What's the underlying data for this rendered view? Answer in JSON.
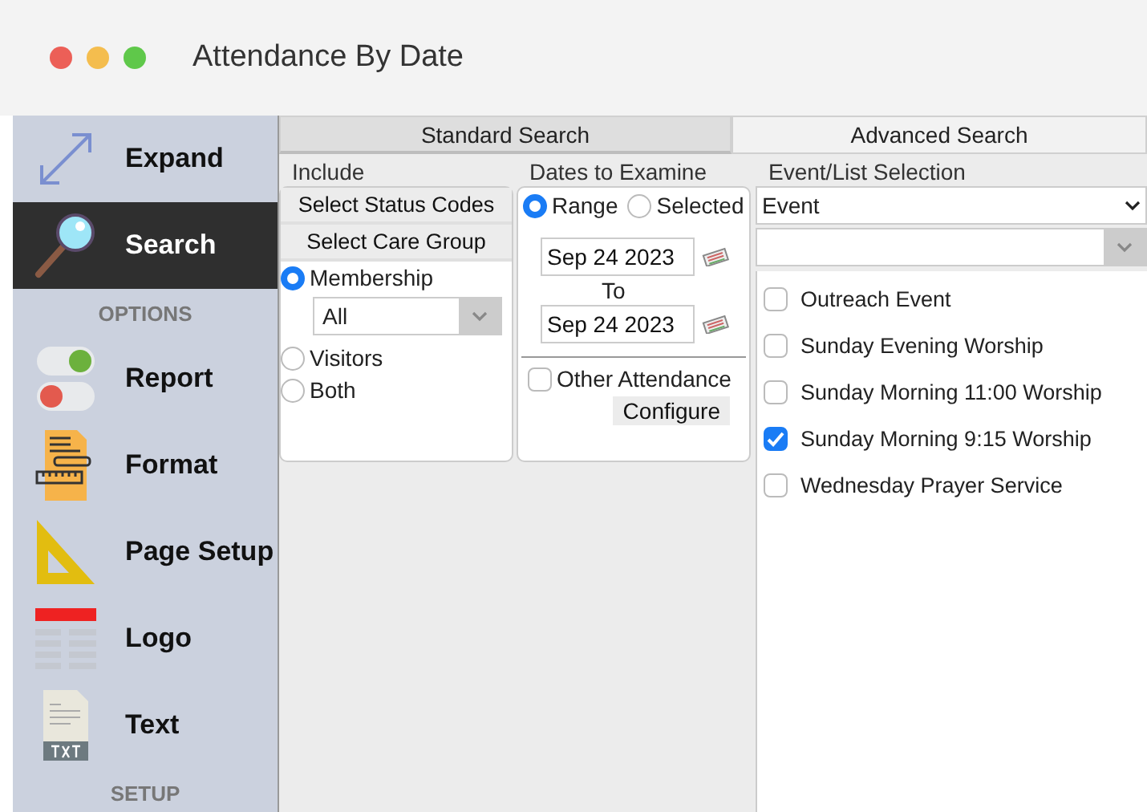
{
  "window": {
    "title": "Attendance By Date"
  },
  "sidebar": {
    "items": [
      {
        "kind": "item",
        "label": "Expand",
        "selected": false
      },
      {
        "kind": "item",
        "label": "Search",
        "selected": true
      },
      {
        "kind": "header",
        "label": "OPTIONS"
      },
      {
        "kind": "item",
        "label": "Report",
        "selected": false
      },
      {
        "kind": "item",
        "label": "Format",
        "selected": false
      },
      {
        "kind": "item",
        "label": "Page Setup",
        "selected": false
      },
      {
        "kind": "item",
        "label": "Logo",
        "selected": false
      },
      {
        "kind": "item",
        "label": "Text",
        "selected": false
      },
      {
        "kind": "header",
        "label": "SETUP"
      }
    ]
  },
  "tabs": [
    {
      "label": "Standard Search",
      "selected": true
    },
    {
      "label": "Advanced Search",
      "selected": false
    }
  ],
  "include": {
    "heading": "Include",
    "buttons": [
      "Select Status Codes",
      "Select Care Group"
    ],
    "options": [
      {
        "label": "Membership",
        "selected": true
      },
      {
        "label": "Visitors",
        "selected": false
      },
      {
        "label": "Both",
        "selected": false
      }
    ],
    "membership_select": {
      "value": "All"
    }
  },
  "dates": {
    "heading": "Dates to Examine",
    "modes": [
      {
        "label": "Range",
        "selected": true
      },
      {
        "label": "Selected",
        "selected": false
      }
    ],
    "from": "Sep 24 2023",
    "to_label": "To",
    "to": "Sep 24 2023",
    "other_attendance": {
      "label": "Other Attendance",
      "checked": false
    },
    "configure_button": "Configure"
  },
  "events": {
    "heading": "Event/List Selection",
    "type_select": {
      "value": "Event"
    },
    "items": [
      {
        "label": "Outreach Event",
        "checked": false
      },
      {
        "label": "Sunday Evening Worship",
        "checked": false
      },
      {
        "label": "Sunday Morning 11:00 Worship",
        "checked": false
      },
      {
        "label": "Sunday Morning 9:15 Worship",
        "checked": true
      },
      {
        "label": "Wednesday Prayer Service",
        "checked": false
      }
    ]
  }
}
